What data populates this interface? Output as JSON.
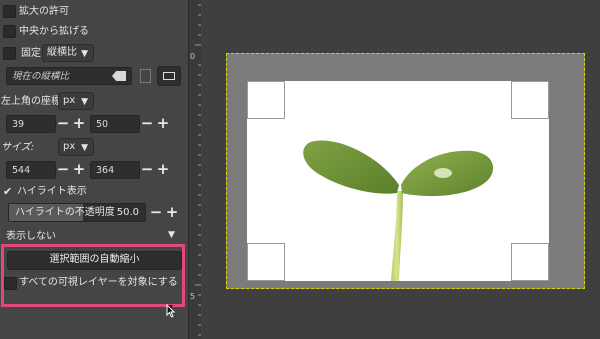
{
  "options": {
    "allow_growing": "拡大の許可",
    "expand_from_center": "中央から拡げる",
    "fixed_label": "固定",
    "fixed_mode": "縦横比",
    "aspect_field_value": "現在の縦横比",
    "position_label": "左上角の座標:",
    "position_unit": "px",
    "position_x": "39",
    "position_y": "50",
    "size_label": "サイズ:",
    "size_unit": "px",
    "size_w": "544",
    "size_h": "364",
    "highlight_label": "ハイライト表示",
    "highlight_opacity_label": "ハイライトの不透明度",
    "highlight_opacity_value": "50.0",
    "guides_value": "表示しない",
    "auto_shrink_button": "選択範囲の自動縮小",
    "shrink_merged_label": "すべての可視レイヤーを対象にする"
  },
  "ruler": {
    "labels": [
      "0",
      "5"
    ]
  },
  "colors": {
    "accent_highlight": "#e0477f",
    "layer_boundary": "#d8d800"
  }
}
